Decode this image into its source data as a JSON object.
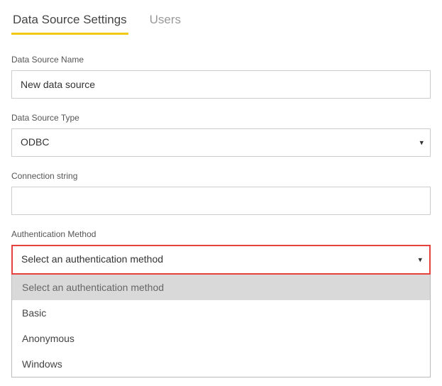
{
  "tabs": {
    "settings_label": "Data Source Settings",
    "users_label": "Users"
  },
  "form": {
    "name_label": "Data Source Name",
    "name_value": "New data source",
    "type_label": "Data Source Type",
    "type_value": "ODBC",
    "conn_label": "Connection string",
    "conn_value": "",
    "auth_label": "Authentication Method",
    "auth_placeholder": "Select an authentication method"
  },
  "auth_options": {
    "opt0": "Select an authentication method",
    "opt1": "Basic",
    "opt2": "Anonymous",
    "opt3": "Windows"
  }
}
